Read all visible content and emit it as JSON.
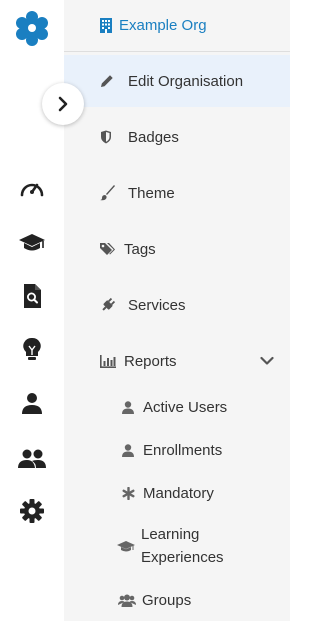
{
  "org": {
    "name": "Example Org"
  },
  "menu": {
    "items": [
      {
        "label": "Edit Organisation",
        "icon": "pencil-icon",
        "active": true
      },
      {
        "label": "Badges",
        "icon": "shield-icon"
      },
      {
        "label": "Theme",
        "icon": "paintbrush-icon"
      },
      {
        "label": "Tags",
        "icon": "tags-icon"
      },
      {
        "label": "Services",
        "icon": "plug-icon"
      },
      {
        "label": "Reports",
        "icon": "bar-chart-icon",
        "expanded": true
      }
    ],
    "report_items": [
      {
        "label": "Active Users",
        "icon": "user-icon"
      },
      {
        "label": "Enrollments",
        "icon": "user-icon"
      },
      {
        "label": "Mandatory",
        "icon": "asterisk-icon"
      },
      {
        "label": "Learning Experiences",
        "icon": "graduation-cap-icon"
      },
      {
        "label": "Groups",
        "icon": "users-icon"
      }
    ]
  },
  "rail": {
    "icons": [
      "speedometer-icon",
      "graduation-cap-icon",
      "file-search-icon",
      "lightbulb-icon",
      "person-icon",
      "people-icon",
      "gear-icon"
    ]
  },
  "colors": {
    "accent": "#1a7fc1",
    "active_bg": "#e9f1fb",
    "panel_bg": "#f5f5f5",
    "text": "#333333",
    "icon": "#555555"
  }
}
